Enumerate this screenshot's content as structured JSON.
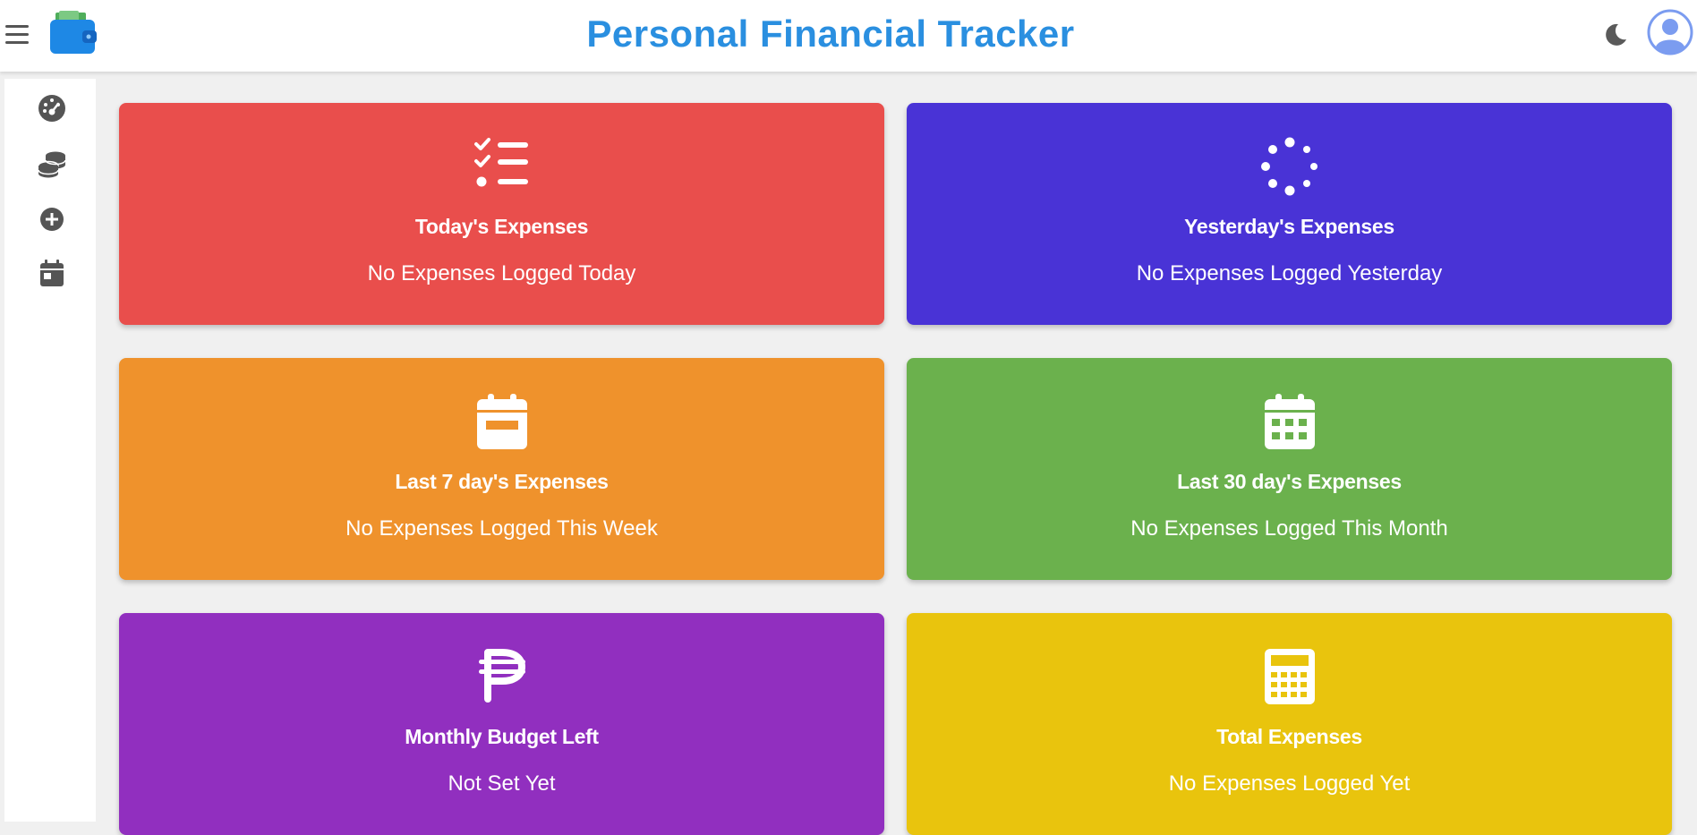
{
  "header": {
    "title": "Personal Financial Tracker",
    "logo_icon": "wallet-icon",
    "menu_icon": "hamburger-menu-icon",
    "theme_icon": "moon-icon",
    "avatar_icon": "user-avatar-icon",
    "title_color": "#2a8fe0"
  },
  "sidebar": {
    "items": [
      {
        "icon": "dashboard-gauge-icon"
      },
      {
        "icon": "coins-stack-icon"
      },
      {
        "icon": "add-circle-icon"
      },
      {
        "icon": "calendar-icon"
      }
    ],
    "icon_color": "#555555"
  },
  "cards": [
    {
      "title": "Today's Expenses",
      "value": "No Expenses Logged Today",
      "icon": "checklist-icon",
      "color": "#e94e4c"
    },
    {
      "title": "Yesterday's Expenses",
      "value": "No Expenses Logged Yesterday",
      "icon": "spinner-icon",
      "color": "#4933d6"
    },
    {
      "title": "Last 7 day's Expenses",
      "value": "No Expenses Logged This Week",
      "icon": "calendar-week-icon",
      "color": "#ef922c"
    },
    {
      "title": "Last 30 day's Expenses",
      "value": "No Expenses Logged This Month",
      "icon": "calendar-month-icon",
      "color": "#6bb14d"
    },
    {
      "title": "Monthly Budget Left",
      "value": "Not Set Yet",
      "icon": "peso-sign-icon",
      "color": "#912fbf"
    },
    {
      "title": "Total Expenses",
      "value": "No Expenses Logged Yet",
      "icon": "calculator-icon",
      "color": "#e9c40d"
    }
  ]
}
